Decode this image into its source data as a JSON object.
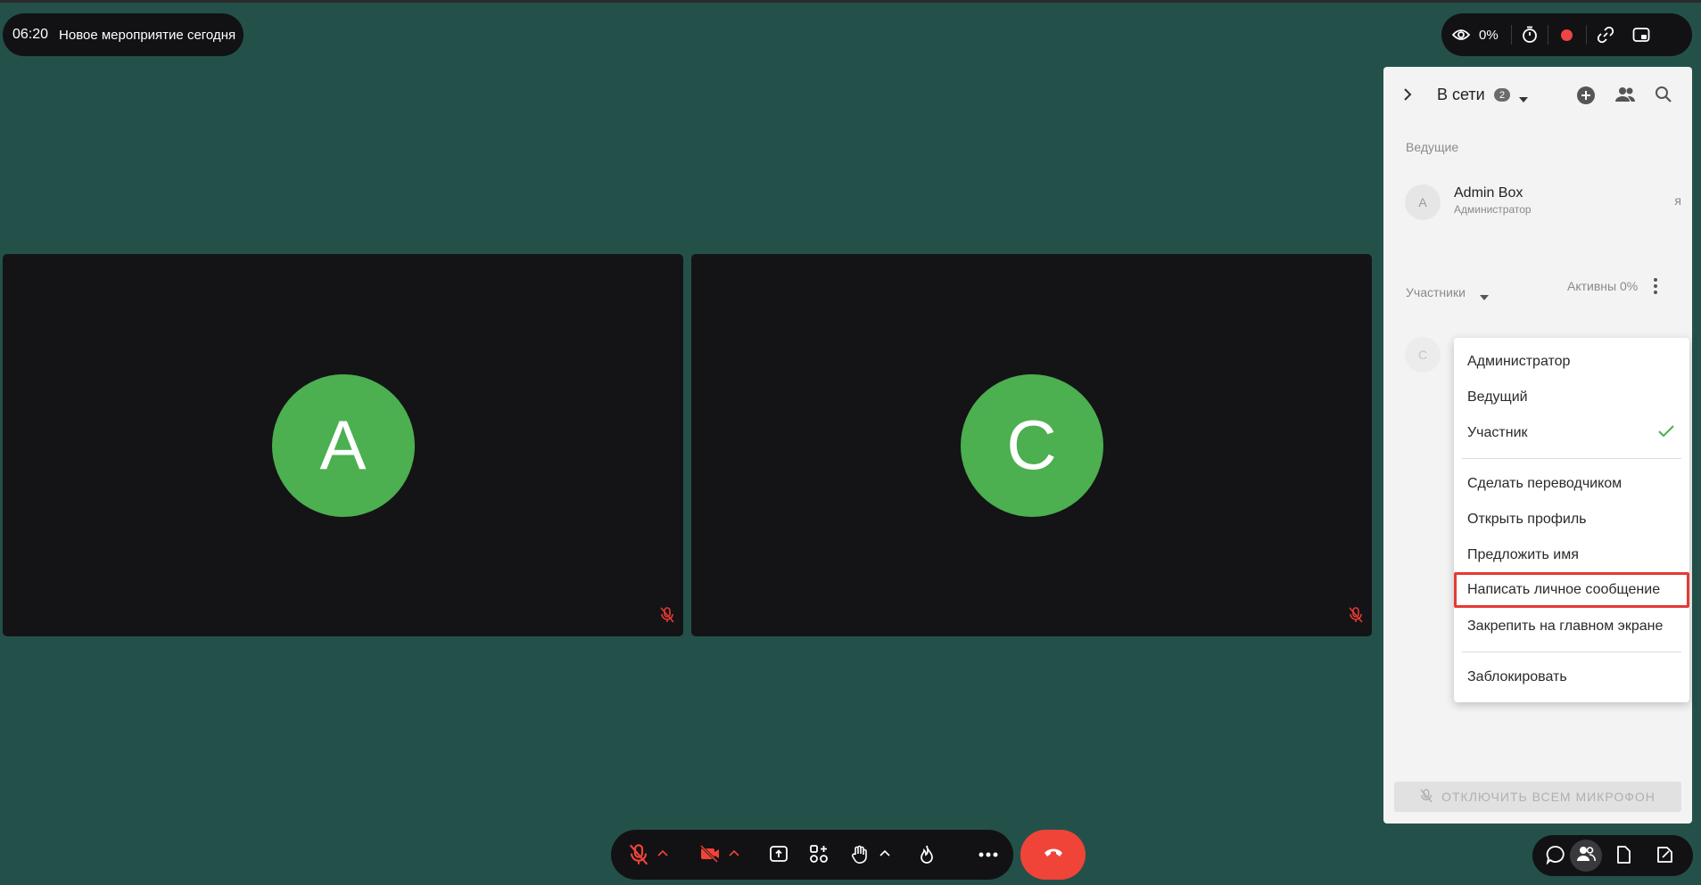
{
  "header": {
    "time": "06:20",
    "event_title": "Новое мероприятие сегодня"
  },
  "top_controls": {
    "views_percent": "0%",
    "icons": [
      "eye-icon",
      "timer-icon",
      "record-icon",
      "link-icon",
      "picture-in-picture-icon"
    ]
  },
  "tiles": [
    {
      "initial": "A",
      "mic": "muted"
    },
    {
      "initial": "C",
      "mic": "muted"
    }
  ],
  "panel": {
    "title": "В сети",
    "online_count": "2",
    "hosts_section": "Ведущие",
    "host": {
      "initial": "A",
      "name": "Admin Box",
      "role": "Администратор",
      "me_label": "я"
    },
    "participants_label": "Участники",
    "active_label": "Активны 0%",
    "participant_initial": "C",
    "mute_all_label": "ОТКЛЮЧИТЬ ВСЕМ МИКРОФОН"
  },
  "context_menu": {
    "items": [
      "Администратор",
      "Ведущий",
      "Участник",
      "Сделать переводчиком",
      "Открыть профиль",
      "Предложить имя",
      "Написать личное сообщение",
      "Закрепить на главном экране",
      "Заблокировать"
    ],
    "checked_item": "Участник",
    "highlighted_item": "Написать личное сообщение"
  },
  "toolbar": {
    "icons": [
      "mic-off-icon",
      "camera-off-icon",
      "share-screen-icon",
      "apps-icon",
      "raise-hand-icon",
      "reaction-icon",
      "more-icon",
      "end-call-icon"
    ]
  },
  "bottom_right": {
    "icons": [
      "chat-icon",
      "participants-icon",
      "files-icon",
      "notes-icon"
    ]
  },
  "colors": {
    "background": "#23514a",
    "avatar_green": "#4caf50",
    "end_call": "#f04438",
    "highlight_border": "#e53935",
    "check_green": "#4caf50"
  }
}
